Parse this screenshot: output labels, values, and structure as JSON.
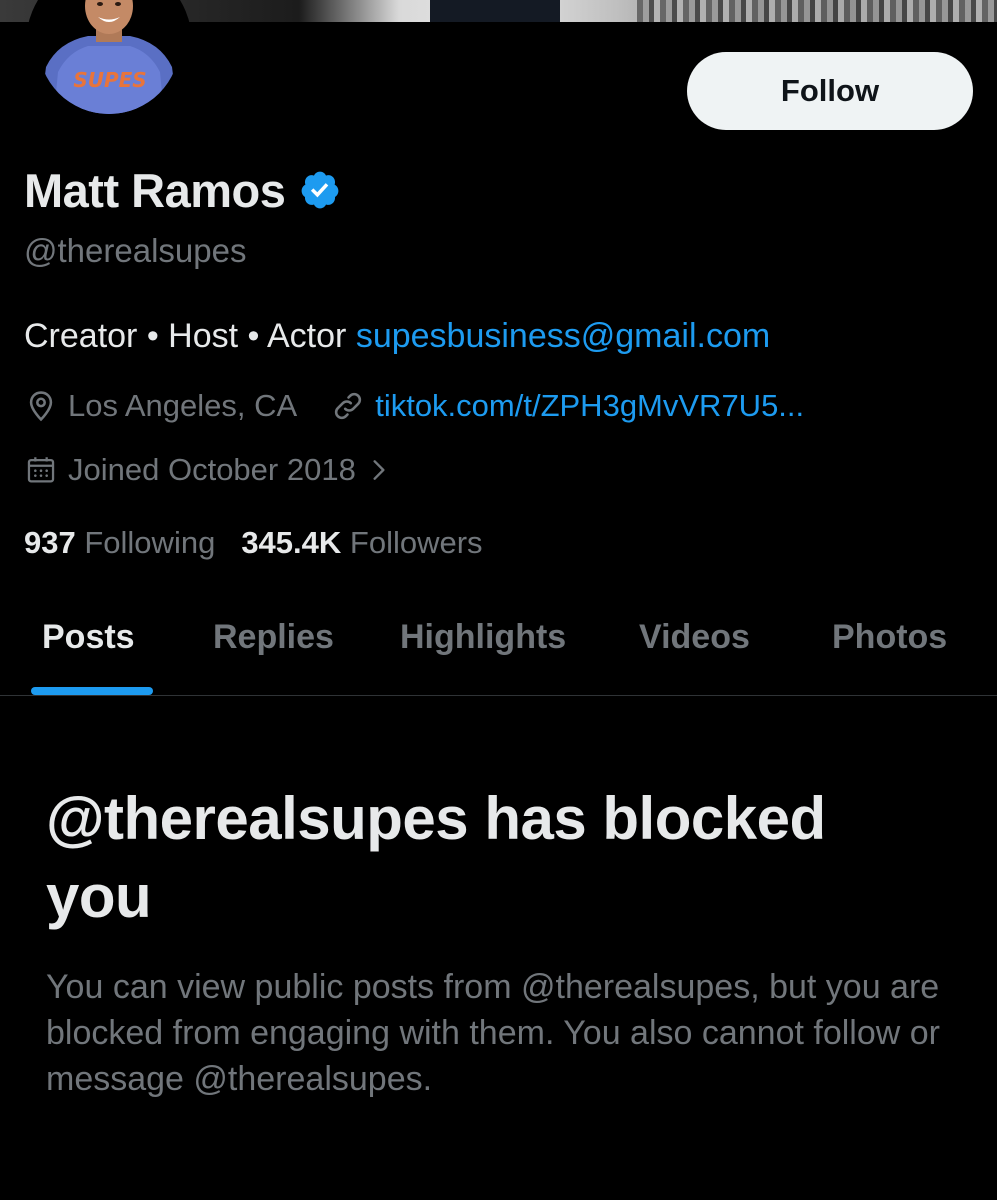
{
  "profile": {
    "name": "Matt Ramos",
    "handle": "@therealsupes",
    "avatar_shirt_text": "SUPES",
    "follow_label": "Follow",
    "bio_text": "Creator • Host • Actor ",
    "bio_email": "supesbusiness@gmail.com",
    "location": "Los Angeles, CA",
    "website": "tiktok.com/t/ZPH3gMvVR7U5...",
    "joined": "Joined October 2018",
    "following_count": "937",
    "following_label": "Following",
    "followers_count": "345.4K",
    "followers_label": "Followers"
  },
  "icons": {
    "verified": "verified-badge-icon",
    "location": "location-pin-icon",
    "link": "link-icon",
    "calendar": "calendar-icon",
    "chevron": "chevron-right-icon"
  },
  "tabs": [
    {
      "label": "Posts",
      "active": true
    },
    {
      "label": "Replies",
      "active": false
    },
    {
      "label": "Highlights",
      "active": false
    },
    {
      "label": "Videos",
      "active": false
    },
    {
      "label": "Photos",
      "active": false
    }
  ],
  "blocked": {
    "title": "@therealsupes has blocked you",
    "description": "You can view public posts from @therealsupes, but you are blocked from engaging with them. You also cannot follow or message @therealsupes."
  },
  "colors": {
    "background": "#000000",
    "primary_text": "#e7e9ea",
    "secondary_text": "#71767b",
    "accent": "#1d9bf0",
    "follow_button_bg": "#eff3f4"
  }
}
